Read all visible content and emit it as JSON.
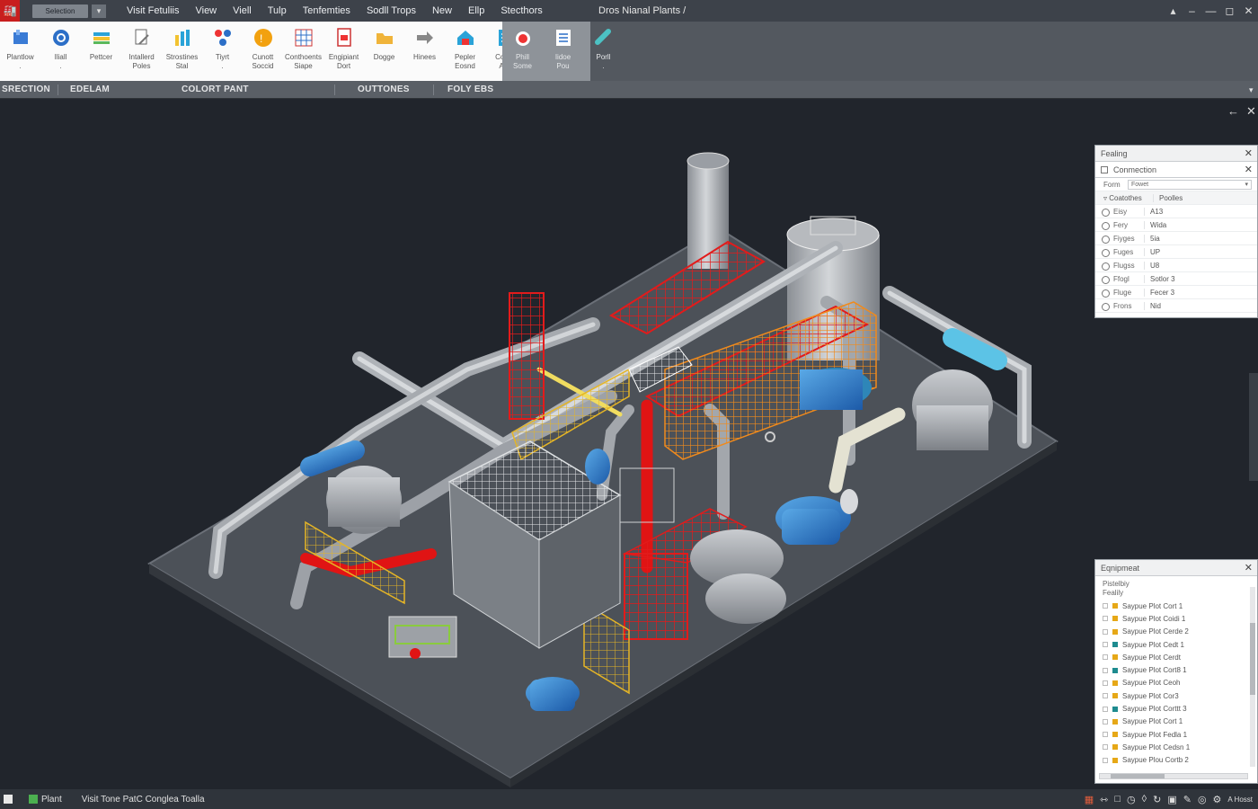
{
  "titlebar": {
    "quick_access": "Selection",
    "menus": [
      "Visit Fetuliis",
      "View",
      "Viell",
      "Tulp",
      "Tenfemties",
      "Sodll Trops",
      "New",
      "Ellp",
      "Stecthors"
    ],
    "doc_title": "Dros Nianal Plants /"
  },
  "ribbon": {
    "tools": [
      {
        "label": "Plantlow\n.",
        "icon": "plant-icon"
      },
      {
        "label": "Iliall\n.",
        "icon": "globe-icon"
      },
      {
        "label": "Pettcer",
        "icon": "layers-icon"
      },
      {
        "label": "Intallerd\nPoles",
        "icon": "edit-icon"
      },
      {
        "label": "Strostines\nStal",
        "icon": "bars-icon"
      },
      {
        "label": "Tiyrt\n.",
        "icon": "nodes-icon"
      },
      {
        "label": "Cunott\nSoccid",
        "icon": "coin-icon"
      },
      {
        "label": "Conthoents\nSiape",
        "icon": "grid-icon"
      },
      {
        "label": "Engipiant\nDort",
        "icon": "document-icon"
      },
      {
        "label": "Dogge",
        "icon": "folder-icon"
      },
      {
        "label": "Hinees",
        "icon": "arrow-icon"
      },
      {
        "label": "Pepler\nEosnd",
        "icon": "house-icon"
      },
      {
        "label": "Coilon\nAdh",
        "icon": "sheet-icon"
      }
    ],
    "tools_secondary": [
      {
        "label": "Phill\nSome",
        "icon": "drop-icon"
      },
      {
        "label": "Iidoe\nPou",
        "icon": "list-icon"
      },
      {
        "label": "Porll\n.",
        "icon": "pipe-icon"
      }
    ],
    "panel_tabs": [
      "SRECTION",
      "EDELAM",
      "COLORT PANT",
      "OUTTONES",
      "FOLY EBS"
    ]
  },
  "properties": {
    "header": "Fealing",
    "sub": "Conmection",
    "form_label": "Form",
    "form_value": "Fowet",
    "group_key": "Coatothes",
    "group_value": "Poolles",
    "rows": [
      [
        "Eisy",
        "A13"
      ],
      [
        "Fery",
        "Wida"
      ],
      [
        "Fiyges",
        "5ia"
      ],
      [
        "Fuges",
        "UP"
      ],
      [
        "Flugss",
        "U8"
      ],
      [
        "Ffogl",
        "Sotlor 3"
      ],
      [
        "Fluge",
        "Fecer 3"
      ],
      [
        "Frons",
        "Nid"
      ]
    ]
  },
  "equipment": {
    "header": "Eqnipmeat",
    "line1": "Pistelbiy",
    "line2": "Fealily",
    "items": [
      {
        "label": "Saypue Plot Cort 1",
        "color": "#e6a817"
      },
      {
        "label": "Saypue Plot Coidi 1",
        "color": "#e6a817"
      },
      {
        "label": "Saypue Plot Cerde 2",
        "color": "#e6a817"
      },
      {
        "label": "Saypue Plot Cedt 1",
        "color": "#1e8b8f"
      },
      {
        "label": "Saypue Plot Cerdt",
        "color": "#e6a817"
      },
      {
        "label": "Saypue Plot Cort8 1",
        "color": "#1e8b8f"
      },
      {
        "label": "Saypue Plot Ceoh",
        "color": "#e6a817"
      },
      {
        "label": "Saypue Plot Cor3",
        "color": "#e6a817"
      },
      {
        "label": "Saypue Plot Corttt 3",
        "color": "#1e8b8f"
      },
      {
        "label": "Saypue Plot Cort 1",
        "color": "#e6a817"
      },
      {
        "label": "Saypue Plot Fedla 1",
        "color": "#e6a817"
      },
      {
        "label": "Saypue Plot Cedsn 1",
        "color": "#e6a817"
      },
      {
        "label": "Saypue Plou Cortb 2",
        "color": "#e6a817"
      }
    ]
  },
  "status": {
    "mode": "Plant",
    "text": "Visit Tone PatC Conglea Toalla",
    "right_text": "A Hosst"
  }
}
